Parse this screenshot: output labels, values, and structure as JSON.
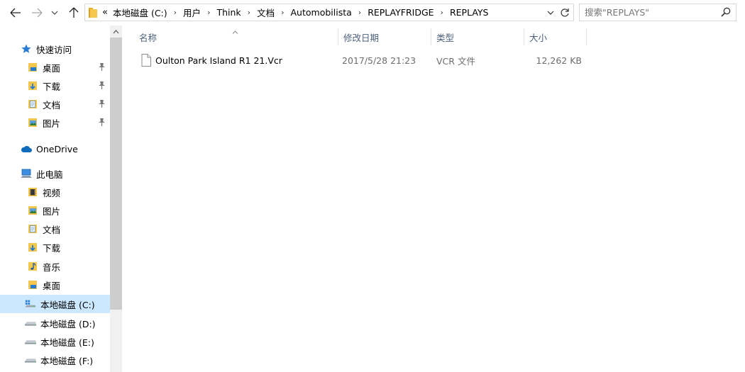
{
  "nav": {
    "back_icon": "arrow-left-icon",
    "forward_icon": "arrow-right-icon",
    "recent_icon": "chevron-down-icon",
    "up_icon": "arrow-up-icon"
  },
  "address": {
    "overflow": "«",
    "breadcrumbs": [
      "本地磁盘 (C:)",
      "用户",
      "Think",
      "文档",
      "Automobilista",
      "REPLAYFRIDGE",
      "REPLAYS"
    ],
    "separator": "›"
  },
  "search": {
    "placeholder": "搜索\"REPLAYS\""
  },
  "sidebar": {
    "items": [
      {
        "label": "快速访问",
        "icon": "star-icon",
        "pinned": false
      },
      {
        "label": "桌面",
        "icon": "desktop-folder-icon",
        "pinned": true
      },
      {
        "label": "下载",
        "icon": "downloads-folder-icon",
        "pinned": true
      },
      {
        "label": "文档",
        "icon": "documents-folder-icon",
        "pinned": true
      },
      {
        "label": "图片",
        "icon": "pictures-folder-icon",
        "pinned": true
      },
      {
        "label": "OneDrive",
        "icon": "cloud-icon",
        "pinned": false
      },
      {
        "label": "此电脑",
        "icon": "computer-icon",
        "pinned": false
      },
      {
        "label": "视频",
        "icon": "videos-folder-icon",
        "pinned": false
      },
      {
        "label": "图片",
        "icon": "pictures-folder-icon",
        "pinned": false
      },
      {
        "label": "文档",
        "icon": "documents-folder-icon",
        "pinned": false
      },
      {
        "label": "下载",
        "icon": "downloads-folder-icon",
        "pinned": false
      },
      {
        "label": "音乐",
        "icon": "music-folder-icon",
        "pinned": false
      },
      {
        "label": "桌面",
        "icon": "desktop-folder-icon",
        "pinned": false
      },
      {
        "label": "本地磁盘 (C:)",
        "icon": "system-drive-icon",
        "pinned": false,
        "selected": true
      },
      {
        "label": "本地磁盘 (D:)",
        "icon": "drive-icon",
        "pinned": false
      },
      {
        "label": "本地磁盘 (E:)",
        "icon": "drive-icon",
        "pinned": false
      },
      {
        "label": "本地磁盘 (F:)",
        "icon": "drive-icon",
        "pinned": false
      }
    ]
  },
  "columns": {
    "name": "名称",
    "date": "修改日期",
    "type": "类型",
    "size": "大小"
  },
  "files": [
    {
      "name": "Oulton Park Island R1 21.Vcr",
      "date": "2017/5/28 21:23",
      "type": "VCR 文件",
      "size": "12,262 KB"
    }
  ],
  "colors": {
    "selected_bg": "#cce8ff",
    "header_text": "#4c607a",
    "meta_text": "#6d6d6d",
    "folder_yellow": "#f4c64d",
    "onedrive_blue": "#0f6cbd"
  }
}
